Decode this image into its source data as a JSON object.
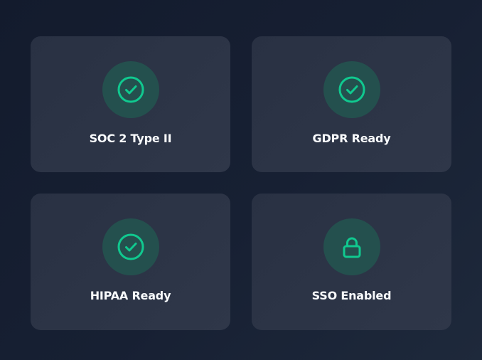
{
  "badges": [
    {
      "label": "SOC 2 Type II",
      "icon": "check-circle-icon"
    },
    {
      "label": "GDPR Ready",
      "icon": "check-circle-icon"
    },
    {
      "label": "HIPAA Ready",
      "icon": "check-circle-icon"
    },
    {
      "label": "SSO Enabled",
      "icon": "lock-icon"
    }
  ],
  "colors": {
    "background": "#172033",
    "card": "#2c3446",
    "icon_bg": "#24504e",
    "accent": "#10c98f",
    "text": "#f8fafc"
  }
}
